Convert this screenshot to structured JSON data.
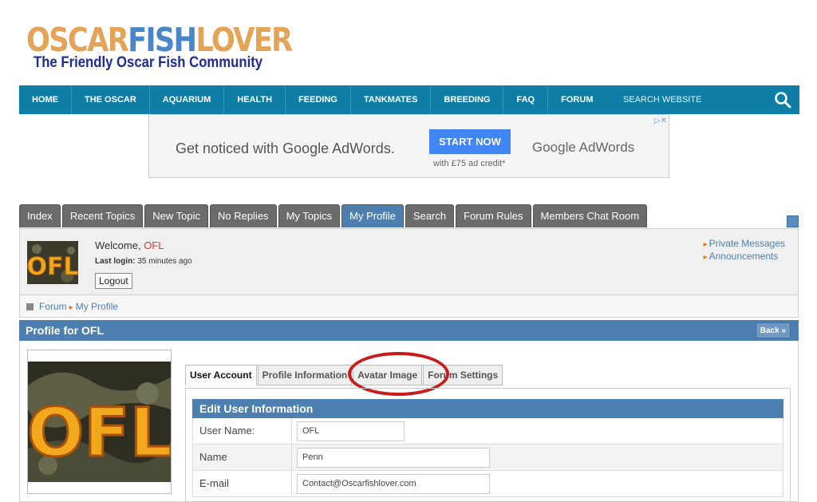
{
  "logo": {
    "part1": "OSCAR",
    "part2": "FISH",
    "part3": "LOVER",
    "tagline": "The Friendly Oscar Fish Community"
  },
  "nav": {
    "items": [
      "HOME",
      "THE OSCAR",
      "AQUARIUM",
      "HEALTH",
      "FEEDING",
      "TANKMATES",
      "BREEDING",
      "FAQ",
      "FORUM"
    ],
    "search_label": "SEARCH WEBSITE",
    "search_icon": "search-icon"
  },
  "ad": {
    "headline": "Get noticed with Google AdWords.",
    "button": "START NOW",
    "sub": "with £75 ad credit*",
    "brand": "Google AdWords",
    "close": "▷✕"
  },
  "forum_tabs": [
    "Index",
    "Recent Topics",
    "New Topic",
    "No Replies",
    "My Topics",
    "My Profile",
    "Search",
    "Forum Rules",
    "Members Chat Room"
  ],
  "welcome": {
    "greeting": "Welcome,",
    "user": "OFL",
    "last_login_label": "Last login:",
    "last_login_value": "35 minutes ago",
    "logout": "Logout",
    "links": [
      "Private Messages",
      "Announcements"
    ]
  },
  "breadcrumb": {
    "items": [
      "Forum",
      "My Profile"
    ]
  },
  "profile": {
    "title": "Profile for OFL",
    "back": "Back »",
    "avatar_text": "OFL",
    "tabs": [
      "User Account",
      "Profile Information",
      "Avatar Image",
      "Forum Settings"
    ],
    "form_title": "Edit User Information",
    "fields": [
      {
        "label": "User Name:",
        "value": "OFL"
      },
      {
        "label": "Name",
        "value": "Penn"
      },
      {
        "label": "E-mail",
        "value": "Contact@Oscarfishlover.com"
      }
    ]
  },
  "colors": {
    "nav_bg": "#0e7ea6",
    "accent": "#4d7fb0",
    "tab_bg": "#6b6b6b",
    "highlight_circle": "#c81b1b"
  }
}
